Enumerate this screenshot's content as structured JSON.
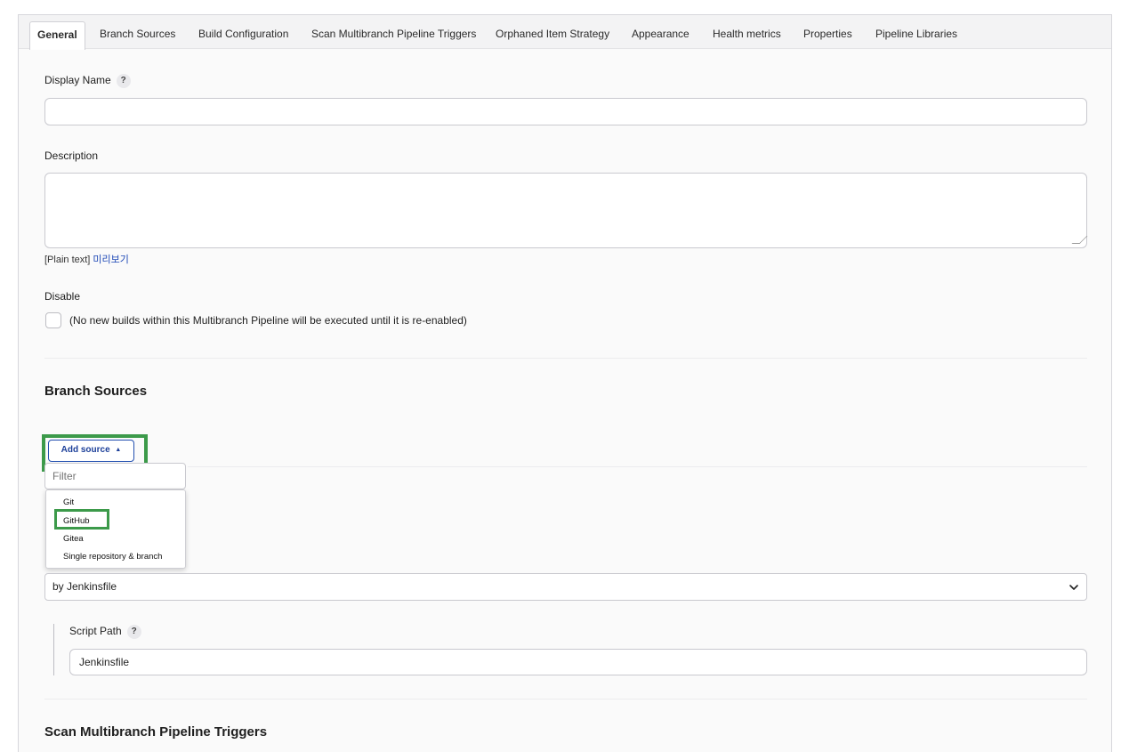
{
  "tabs": [
    {
      "label": "General",
      "active": true
    },
    {
      "label": "Branch Sources"
    },
    {
      "label": "Build Configuration"
    },
    {
      "label": "Scan Multibranch Pipeline Triggers"
    },
    {
      "label": "Orphaned Item Strategy"
    },
    {
      "label": "Appearance"
    },
    {
      "label": "Health metrics"
    },
    {
      "label": "Properties"
    },
    {
      "label": "Pipeline Libraries"
    }
  ],
  "general": {
    "display_name_label": "Display Name",
    "display_name_value": "",
    "help_glyph": "?",
    "description_label": "Description",
    "description_value": "",
    "markup_hint": "[Plain text]",
    "preview_link": "미리보기",
    "disable_label": "Disable",
    "disable_checkbox_text": "(No new builds within this Multibranch Pipeline will be executed until it is re-enabled)",
    "disable_checked": false
  },
  "branch_sources": {
    "title": "Branch Sources",
    "add_source_button": "Add source",
    "filter_placeholder": "Filter",
    "menu_items": [
      "Git",
      "GitHub",
      "Gitea",
      "Single repository & branch"
    ],
    "highlighted_item": "GitHub"
  },
  "build_configuration": {
    "mode_value": "by Jenkinsfile",
    "script_path_label": "Script Path",
    "script_path_value": "Jenkinsfile"
  },
  "triggers": {
    "title": "Scan Multibranch Pipeline Triggers"
  },
  "colors": {
    "highlight": "#3c9a4a",
    "link": "#1c47b6",
    "button_border": "#2350b0"
  },
  "icons": {
    "add_source_caret": "caret-up-icon",
    "select_chevron": "chevron-down-icon",
    "help": "help-icon"
  }
}
